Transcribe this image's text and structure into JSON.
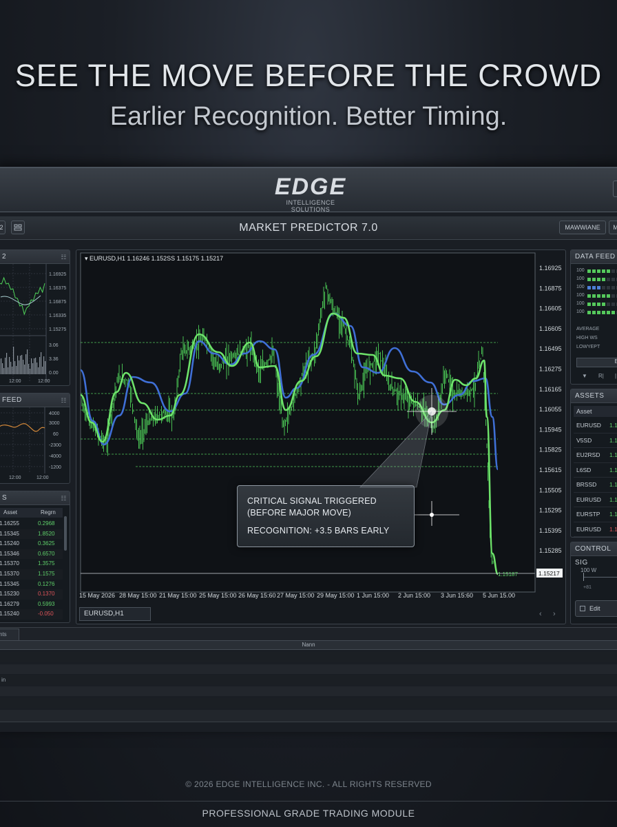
{
  "hero": {
    "headline": "SEE THE MOVE BEFORE THE CROWD",
    "subline": "Earlier Recognition. Better Timing."
  },
  "brand": {
    "logo": "EDGE",
    "tagline": "INTELLIGENCE SOLUTIONS"
  },
  "window": {
    "title": "MARKET PREDICTOR 7.0",
    "right_buttons": [
      "MAWWIANE",
      "M"
    ],
    "left_button_label": "2"
  },
  "left_panels": {
    "panel1": {
      "label": "2",
      "y_ticks": [
        "1.16925",
        "1.16375",
        "1.16875",
        "1.16335",
        "1.15275"
      ],
      "vol_ticks": [
        "3.06",
        "3.36",
        "0.00"
      ],
      "x_ticks": [
        "12:00",
        "12:00"
      ]
    },
    "panel2": {
      "label": "FEED",
      "y_ticks": [
        "4000",
        "3000",
        "60",
        "-2300",
        "-4000",
        "-1200"
      ],
      "x_ticks": [
        "12:00",
        "12:00"
      ]
    },
    "panel3": {
      "label": "S",
      "columns": [
        "Asset",
        "Regrn"
      ],
      "rows": [
        {
          "a": "1.16255",
          "b": "0.2968",
          "c": "#5fd16a"
        },
        {
          "a": "1.15345",
          "b": "1.8520",
          "c": "#5fd16a"
        },
        {
          "a": "1.15240",
          "b": "0.3625",
          "c": "#5fd16a"
        },
        {
          "a": "1.15346",
          "b": "0.6570",
          "c": "#5fd16a"
        },
        {
          "a": "1.15370",
          "b": "1.3575",
          "c": "#5fd16a"
        },
        {
          "a": "1.15370",
          "b": "1.1575",
          "c": "#5fd16a"
        },
        {
          "a": "1.15345",
          "b": "0.1276",
          "c": "#5fd16a"
        },
        {
          "a": "1.15230",
          "b": "0.1370",
          "c": "#e0555a"
        },
        {
          "a": "1.16279",
          "b": "0.5993",
          "c": "#5fd16a"
        },
        {
          "a": "1.15240",
          "b": "-0.050",
          "c": "#e0555a"
        }
      ]
    }
  },
  "chart": {
    "header": "EURUSD,H1  1.16246 1.152SS 1.15175 1.15217",
    "tab": "EURUSD,H1",
    "price_label": "1.15187",
    "last_price_box": "1.15217",
    "y_ticks": [
      "1.16925",
      "1.16875",
      "1.16605",
      "1.16605",
      "1.16495",
      "1.16275",
      "1.16165",
      "1.16055",
      "1.15945",
      "1.15825",
      "1.15615",
      "1.15505",
      "1.15295",
      "1.15395",
      "1.15285",
      "1.15175"
    ],
    "x_ticks": [
      "15 May 2026",
      "28 May 15:00",
      "21 May 15:00",
      "25 May 15:00",
      "26 May 15:60",
      "27 May 15:00",
      "29 May 15:00",
      "1 Jun 15:00",
      "2 Jun 15:00",
      "3 Jun 15:60",
      "5 Jun 15.00"
    ],
    "callout": {
      "line1": "CRITICAL SIGNAL TRIGGERED",
      "line2": "(BEFORE MAJOR MOVE)",
      "line3": "RECOGNITION: +3.5 BARS EARLY"
    },
    "colors": {
      "price": "#4fd35a",
      "fast": "#6ee36a",
      "slow": "#3f6fd6",
      "level": "#53c65c"
    }
  },
  "right_panels": {
    "data_feed": {
      "label": "DATA FEED",
      "rows": [
        "100",
        "100",
        "100",
        "100",
        "100",
        "100"
      ],
      "stats": [
        "AVERAGE",
        "HIGH WS",
        "LOWYEPT"
      ],
      "button": "B",
      "footer": [
        "▼",
        "R|",
        "|"
      ]
    },
    "assets": {
      "label": "ASSETS",
      "column": "Asset",
      "rows": [
        {
          "name": "EURUSD",
          "v": "1.1",
          "c": "#5fd16a"
        },
        {
          "name": "V5SD",
          "v": "1.1",
          "c": "#5fd16a"
        },
        {
          "name": "EU2RSD",
          "v": "1.1",
          "c": "#5fd16a"
        },
        {
          "name": "L6SD",
          "v": "1.1",
          "c": "#5fd16a"
        },
        {
          "name": "BRSSD",
          "v": "1.1",
          "c": "#5fd16a"
        },
        {
          "name": "EURUSD",
          "v": "1.1",
          "c": "#5fd16a"
        },
        {
          "name": "EURSTP",
          "v": "1.1",
          "c": "#5fd16a"
        },
        {
          "name": "EURUSD",
          "v": "1.1",
          "c": "#e0555a"
        }
      ]
    },
    "control": {
      "label": "CONTROL SIG",
      "w_label": "100 W",
      "w_sub": "+81",
      "edit": "Edit"
    }
  },
  "lower": {
    "tab": "nts",
    "header": "Nann",
    "row": "in"
  },
  "footer": {
    "copyright": "© 2026 EDGE INTELLIGENCE INC. - ALL RIGHTS RESERVED",
    "module": "PROFESSIONAL GRADE TRADING MODULE"
  }
}
